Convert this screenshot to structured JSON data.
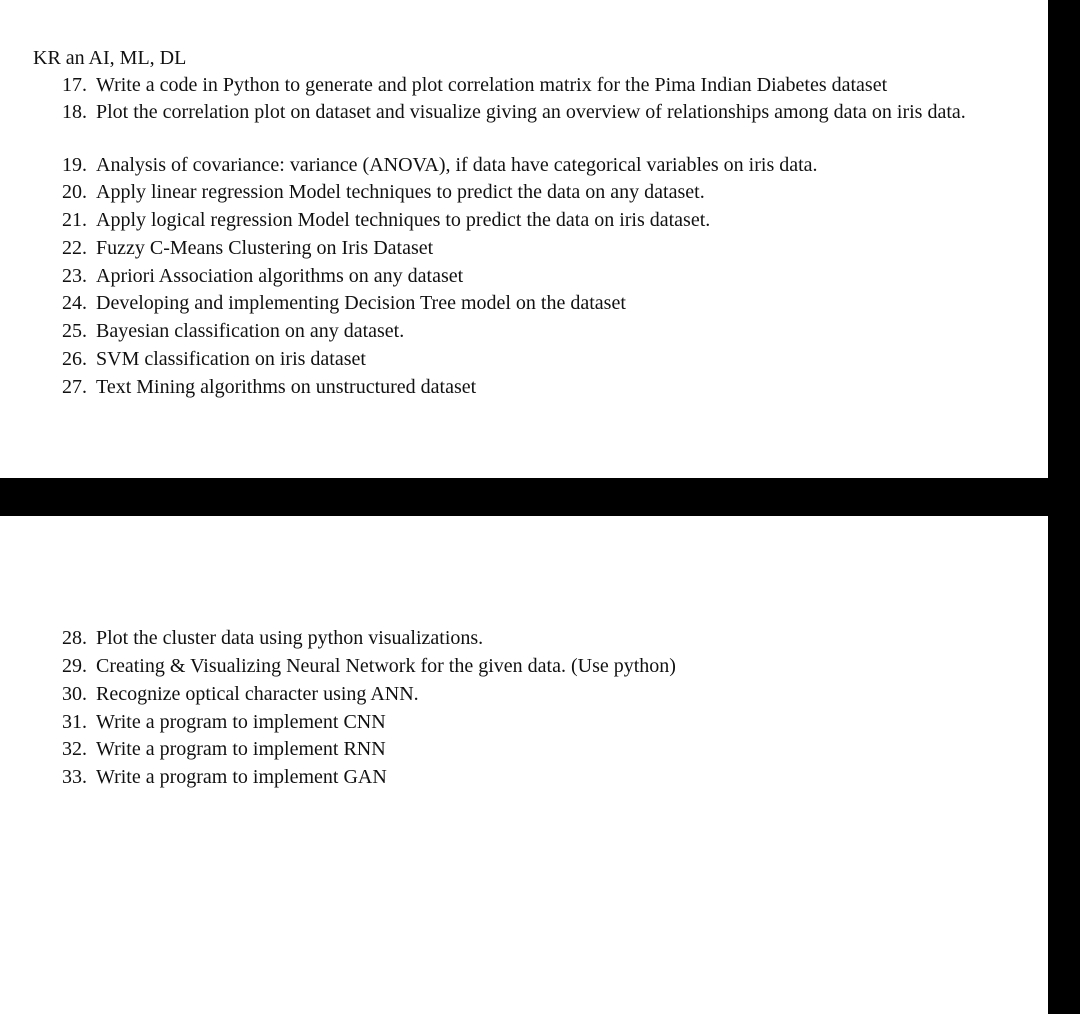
{
  "header": {
    "title": "KR an AI, ML, DL"
  },
  "top_list": [
    {
      "num": "17.",
      "text": "Write a code in Python to generate and plot correlation matrix for the Pima Indian Diabetes dataset"
    },
    {
      "num": "18.",
      "text": "Plot the correlation plot on dataset and visualize giving an overview of relationships among data on iris data."
    },
    {
      "num": "19.",
      "text": "Analysis of covariance: variance (ANOVA), if data have categorical variables on iris data."
    },
    {
      "num": "20.",
      "text": "Apply linear regression Model techniques to predict the data on any dataset."
    },
    {
      "num": "21.",
      "text": "Apply logical regression Model techniques to predict the data on iris dataset."
    },
    {
      "num": "22.",
      "text": "Fuzzy C-Means Clustering on Iris Dataset"
    },
    {
      "num": "23.",
      "text": "Apriori Association algorithms on any dataset"
    },
    {
      "num": "24.",
      "text": "Developing and implementing Decision Tree model on the dataset"
    },
    {
      "num": "25.",
      "text": "Bayesian classification on any dataset."
    },
    {
      "num": "26.",
      "text": "SVM classification on iris dataset"
    },
    {
      "num": "27.",
      "text": "Text Mining algorithms on unstructured dataset"
    }
  ],
  "bottom_list": [
    {
      "num": "28.",
      "text": "Plot the cluster data using python visualizations."
    },
    {
      "num": "29.",
      "text": "Creating & Visualizing Neural Network for the given data. (Use python)"
    },
    {
      "num": "30.",
      "text": "Recognize optical character using ANN."
    },
    {
      "num": "31.",
      "text": "Write a program to implement CNN"
    },
    {
      "num": "32.",
      "text": "Write a program to implement RNN"
    },
    {
      "num": "33.",
      "text": "Write a program to implement GAN"
    }
  ]
}
